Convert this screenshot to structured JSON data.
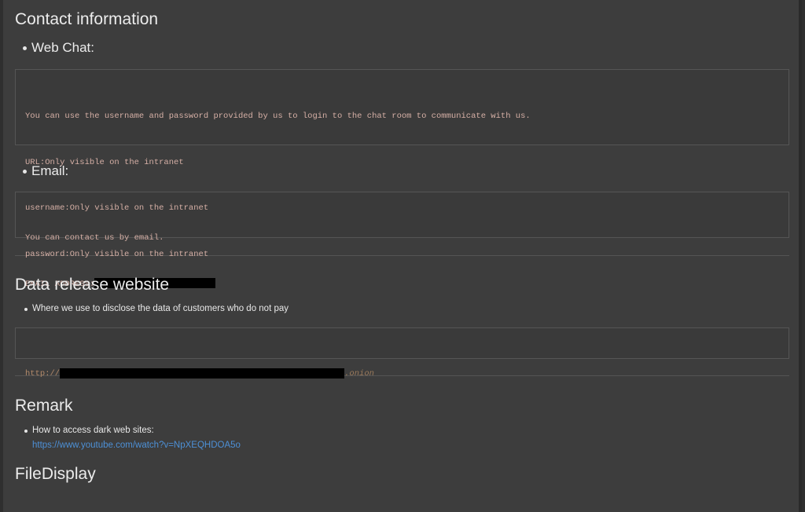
{
  "contact": {
    "heading": "Contact information",
    "webchat": {
      "heading": "Web Chat:",
      "lines": [
        "You can use the username and password provided by us to login to the chat room to communicate with us.",
        "URL:Only visible on the intranet",
        "username:Only visible on the intranet",
        "password:Only visible on the intranet"
      ]
    },
    "email": {
      "heading": "Email:",
      "line1": "You can contact us by email.",
      "address_label": "EMAIL ADDRESS:"
    }
  },
  "data_release": {
    "heading": "Data release website",
    "bullet": "Where we use to disclose the data of customers who do not pay",
    "url_prefix": "http://",
    "url_suffix": ".onion"
  },
  "remark": {
    "heading": "Remark",
    "bullet": "How to access dark web sites:",
    "link": "https://www.youtube.com/watch?v=NpXEQHDOA5o"
  },
  "file_display": {
    "heading": "FileDisplay"
  },
  "colors": {
    "background": "#3d3d3d",
    "code_text": "#d6b0a6",
    "link": "#4d90d6"
  }
}
